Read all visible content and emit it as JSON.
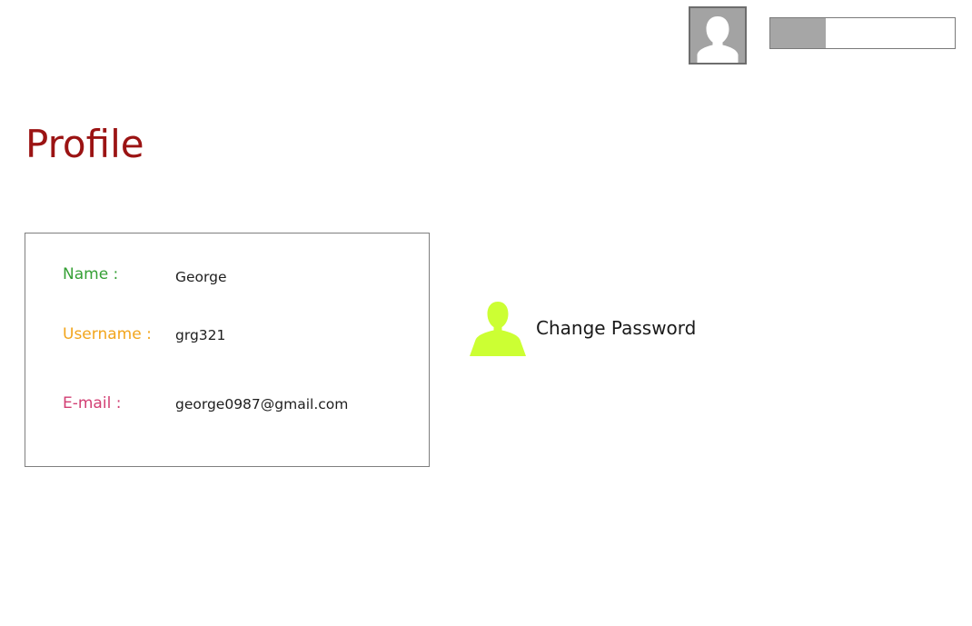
{
  "header": {
    "avatar_icon": "user-silhouette-icon",
    "progress": 0.3
  },
  "page": {
    "title": "Profile"
  },
  "profile": {
    "name_label": "Name :",
    "name_value": "George",
    "username_label": "Username :",
    "username_value": "grg321",
    "email_label": "E-mail :",
    "email_value": "george0987@gmail.com"
  },
  "actions": {
    "change_password_label": "Change Password",
    "change_password_icon": "user-silhouette-icon"
  },
  "colors": {
    "title": "#9b1313",
    "name_label": "#35a035",
    "username_label": "#f2a51c",
    "email_label": "#d23f73",
    "change_password_icon": "#ccff33",
    "avatar_bg": "#a3a3a3",
    "progress_fill": "#a6a6a6"
  }
}
